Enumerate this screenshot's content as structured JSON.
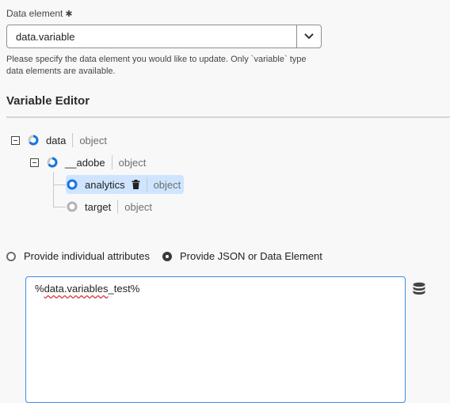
{
  "data_element": {
    "label": "Data element",
    "required_mark": "✱",
    "value": "data.variable",
    "help": "Please specify the data element you would like to update. Only `variable` type data elements are available."
  },
  "variable_editor": {
    "title": "Variable Editor",
    "tree": {
      "root": {
        "name": "data",
        "type": "object"
      },
      "adobe": {
        "name": "__adobe",
        "type": "object"
      },
      "analytics": {
        "name": "analytics",
        "type": "object"
      },
      "target": {
        "name": "target",
        "type": "object"
      }
    }
  },
  "mode": {
    "options": [
      "Provide individual attributes",
      "Provide JSON or Data Element"
    ],
    "selected": "Provide JSON or Data Element"
  },
  "json_input": {
    "value_prefix": "%",
    "value_underlined": "data.variables",
    "value_suffix": "_test%"
  },
  "icons": [
    "chevron-down-icon",
    "collapse-icon",
    "partial-ring-icon",
    "filled-ring-icon",
    "empty-ring-icon",
    "trash-icon",
    "database-icon"
  ],
  "colors": {
    "accent": "#1473e6",
    "selected_bg": "#cfe5ff",
    "focus_border": "#3e8ae4",
    "error_squiggle": "#d7373f"
  }
}
